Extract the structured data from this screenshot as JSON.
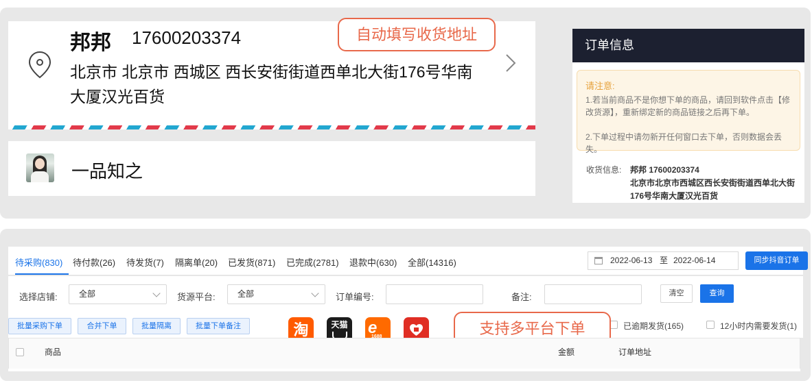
{
  "address_card": {
    "name": "邦邦",
    "phone": "17600203374",
    "address": "北京市 北京市 西城区 西长安街街道西单北大街176号华南大厦汉光百货",
    "callout": "自动填写收货地址"
  },
  "shop": {
    "name": "一品知之"
  },
  "order_panel": {
    "title": "订单信息",
    "notice_title": "请注意:",
    "notice_line1": "1.若当前商品不是你想下单的商品，请回到软件点击【修改货源】，重新绑定新的商品链接之后再下单。",
    "notice_line2": "2.下单过程中请勿新开任何窗口去下单，否则数据会丢失。",
    "receiver_label": "收货信息:",
    "receiver_name_phone": "邦邦 17600203374",
    "receiver_address": "北京市北京市西城区西长安街街道西单北大街176号华南大厦汉光百货"
  },
  "tabs": [
    {
      "label": "待采购(830)",
      "active": true
    },
    {
      "label": "待付款(26)"
    },
    {
      "label": "待发货(7)"
    },
    {
      "label": "隔离单(20)"
    },
    {
      "label": "已发货(871)"
    },
    {
      "label": "已完成(2781)"
    },
    {
      "label": "退款中(630)"
    },
    {
      "label": "全部(14316)"
    }
  ],
  "date_range": {
    "start": "2022-06-13",
    "separator": "至",
    "end": "2022-06-14"
  },
  "sync_button": "同步抖音订单",
  "filters": {
    "shop_label": "选择店铺:",
    "shop_value": "全部",
    "source_label": "货源平台:",
    "source_value": "全部",
    "order_no_label": "订单编号:",
    "order_no_value": "",
    "remark_label": "备注:",
    "remark_value": "",
    "clear_button": "清空",
    "query_button": "查询"
  },
  "actions": {
    "bulk_purchase": "批量采购下单",
    "merge_order": "合并下单",
    "bulk_isolate": "批量隔离",
    "bulk_remark": "批量下单备注"
  },
  "platforms": {
    "taobao": "淘",
    "tmall": "天猫",
    "alibaba_1688": "1688",
    "callout": "支持多平台下单"
  },
  "checks": {
    "overdue": "已逾期发货(165)",
    "within12h": "12小时内需要发货(1)"
  },
  "table": {
    "col_product": "商品",
    "col_amount": "金额",
    "col_address": "订单地址"
  },
  "colors": {
    "accent_blue": "#1a73e8",
    "callout_orange": "#e8684a",
    "header_dark": "#1c2030",
    "notice_bg": "#fdf5e6",
    "notice_title": "#e6a23c"
  }
}
